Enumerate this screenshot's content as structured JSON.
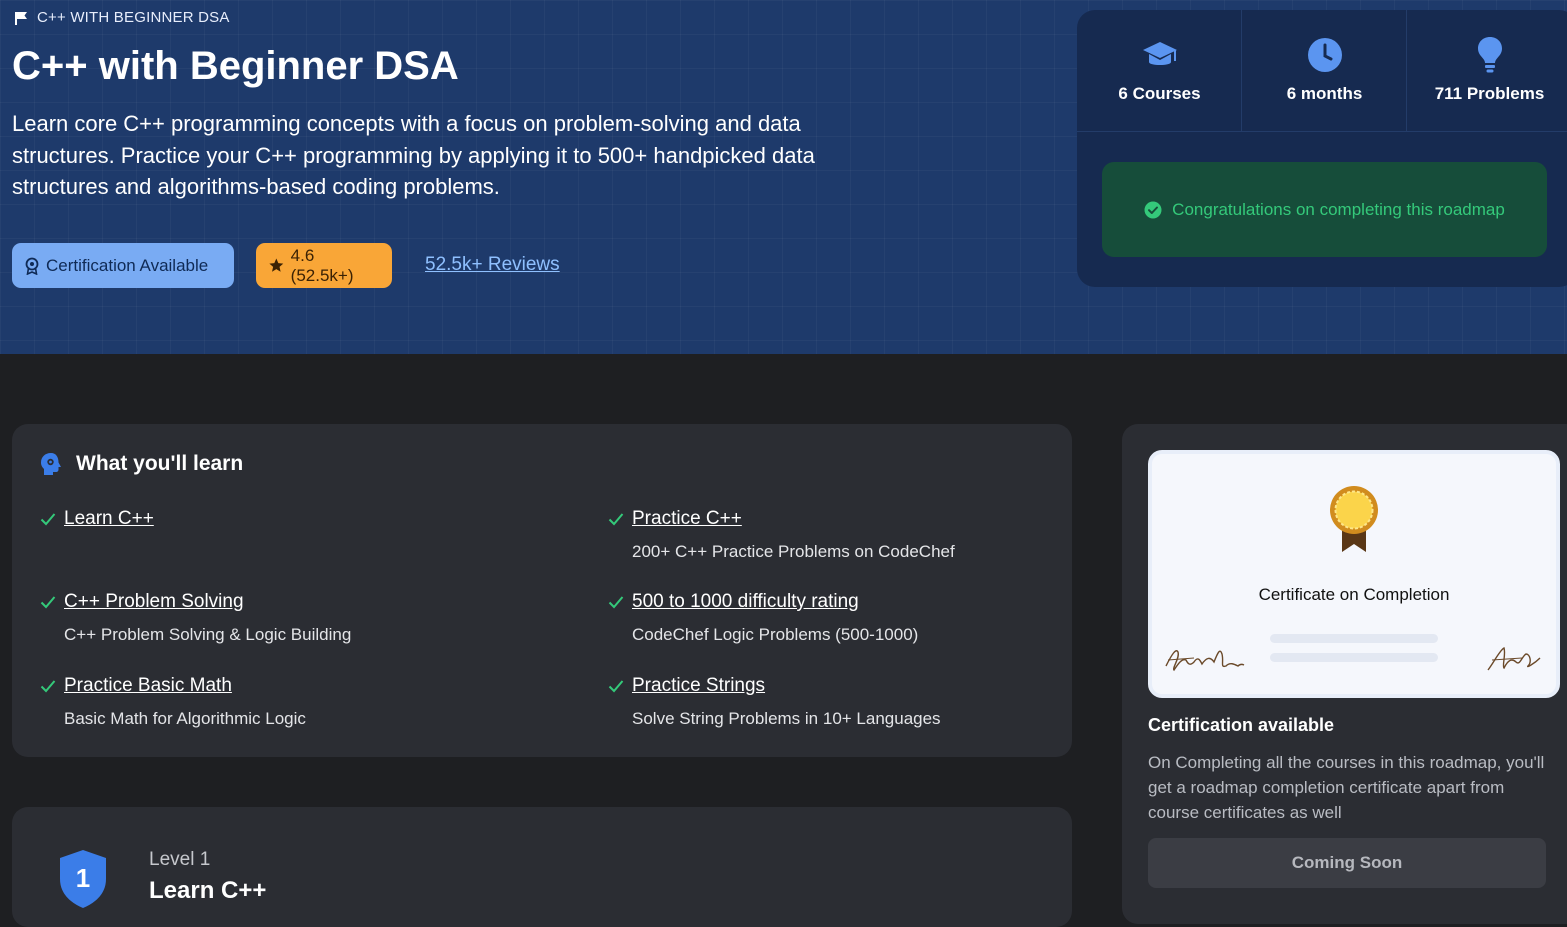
{
  "hero": {
    "breadcrumb": "C++ WITH BEGINNER DSA",
    "title": "C++ with Beginner DSA",
    "description": "Learn core C++ programming concepts with a focus on problem-solving and data structures. Practice your C++ programming by applying it to 500+ handpicked data structures and algorithms-based coding problems.",
    "certification_label": "Certification Available",
    "rating_label": "4.6 (52.5k+)",
    "reviews_link": "52.5k+ Reviews"
  },
  "stats": {
    "items": [
      {
        "label": "6 Courses",
        "icon": "graduation-cap-icon"
      },
      {
        "label": "6 months",
        "icon": "clock-icon"
      },
      {
        "label": "711 Problems",
        "icon": "lightbulb-icon"
      }
    ],
    "completion_message": "Congratulations on completing this roadmap"
  },
  "learn": {
    "heading": "What you'll learn",
    "items": [
      {
        "title": "Learn C++",
        "subtitle": ""
      },
      {
        "title": "Practice C++",
        "subtitle": "200+ C++ Practice Problems on CodeChef"
      },
      {
        "title": "C++ Problem Solving",
        "subtitle": "C++ Problem Solving & Logic Building"
      },
      {
        "title": "500 to 1000 difficulty rating",
        "subtitle": "CodeChef Logic Problems (500-1000)"
      },
      {
        "title": "Practice Basic Math",
        "subtitle": "Basic Math for Algorithmic Logic"
      },
      {
        "title": "Practice Strings",
        "subtitle": "Solve String Problems in 10+ Languages"
      }
    ]
  },
  "level": {
    "number": "1",
    "label": "Level 1",
    "title": "Learn C++"
  },
  "certificate": {
    "card_caption": "Certificate on Completion",
    "heading": "Certification available",
    "description": "On Completing all the courses in this roadmap, you'll get a roadmap completion certificate apart from course certificates as well",
    "button_label": "Coming Soon"
  },
  "colors": {
    "hero_bg": "#1e3a6b",
    "accent_blue": "#79abf3",
    "rating_orange": "#f9a637",
    "success_green": "#34c97a",
    "page_bg": "#1e1f22",
    "card_bg": "#2b2d33"
  }
}
